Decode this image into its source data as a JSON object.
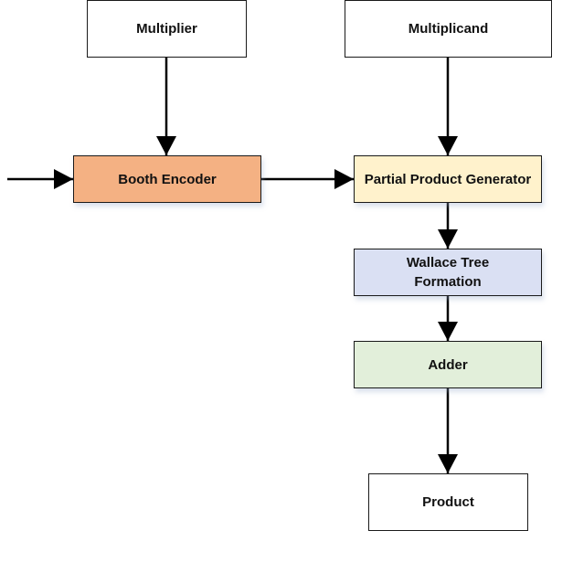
{
  "diagram": {
    "nodes": {
      "multiplier": {
        "label": "Multiplier",
        "fill": "#ffffff"
      },
      "multiplicand": {
        "label": "Multiplicand",
        "fill": "#ffffff"
      },
      "booth_encoder": {
        "label": "Booth Encoder",
        "fill": "#f4b183"
      },
      "partial_product_generator": {
        "label": "Partial Product Generator",
        "fill": "#fff2cc"
      },
      "wallace_tree": {
        "label": "Wallace Tree Formation",
        "fill": "#dae0f3"
      },
      "adder": {
        "label": "Adder",
        "fill": "#e2efda"
      },
      "product": {
        "label": "Product",
        "fill": "#ffffff"
      }
    },
    "edges": [
      {
        "from": "external-input",
        "to": "booth_encoder"
      },
      {
        "from": "multiplier",
        "to": "booth_encoder"
      },
      {
        "from": "booth_encoder",
        "to": "partial_product_generator"
      },
      {
        "from": "multiplicand",
        "to": "partial_product_generator"
      },
      {
        "from": "partial_product_generator",
        "to": "wallace_tree"
      },
      {
        "from": "wallace_tree",
        "to": "adder"
      },
      {
        "from": "adder",
        "to": "product"
      }
    ]
  }
}
